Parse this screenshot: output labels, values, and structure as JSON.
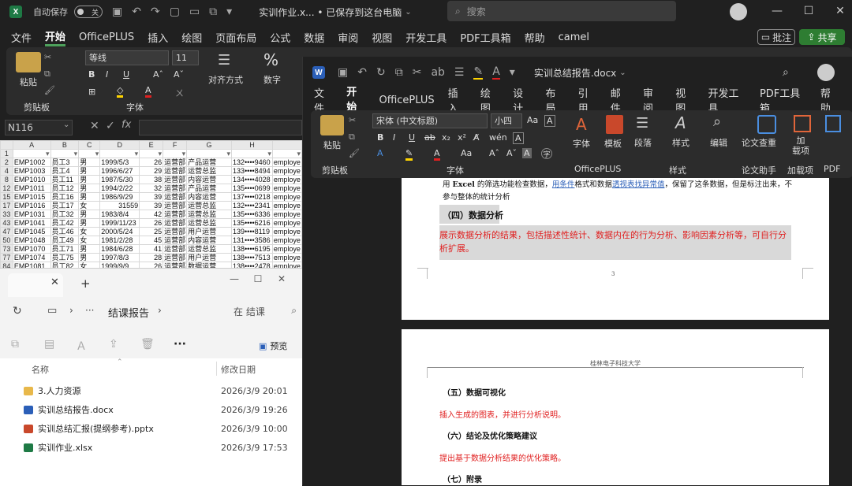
{
  "excel": {
    "autosave_label": "自动保存",
    "autosave_state": "关",
    "title": "实训作业.x... • 已保存到这台电脑",
    "search_placeholder": "搜索",
    "menu": [
      "文件",
      "开始",
      "OfficePLUS",
      "插入",
      "绘图",
      "页面布局",
      "公式",
      "数据",
      "审阅",
      "视图",
      "开发工具",
      "PDF工具箱",
      "帮助",
      "camel"
    ],
    "comment_btn": "批注",
    "share_btn": "共享",
    "ribbon": {
      "paste": "粘贴",
      "clipboard": "剪贴板",
      "font_name": "等线",
      "font_size": "11",
      "font_group": "字体",
      "align": "对齐方式",
      "number": "数字",
      "percent": "%"
    },
    "name_box": "N116",
    "columns": [
      "A",
      "B",
      "C",
      "D",
      "E",
      "F",
      "G",
      "H",
      ""
    ],
    "rows": [
      {
        "n": "2",
        "c": [
          "EMP1002",
          "员工3",
          "男",
          "1999/5/3",
          "26",
          "运营部",
          "产品运营",
          "132••••9460",
          "employe"
        ]
      },
      {
        "n": "4",
        "c": [
          "EMP1003",
          "员工4",
          "男",
          "1996/6/27",
          "29",
          "运营部",
          "运营总监",
          "133••••8494",
          "employe"
        ]
      },
      {
        "n": "8",
        "c": [
          "EMP1010",
          "员工11",
          "男",
          "1987/5/30",
          "38",
          "运营部",
          "内容运营",
          "134••••4028",
          "employe"
        ]
      },
      {
        "n": "12",
        "c": [
          "EMP1011",
          "员工12",
          "男",
          "1994/2/22",
          "32",
          "运营部",
          "产品运营",
          "135••••0699",
          "employe"
        ]
      },
      {
        "n": "15",
        "c": [
          "EMP1015",
          "员工16",
          "男",
          "1986/9/29",
          "39",
          "运营部",
          "内容运营",
          "137••••0218",
          "employe"
        ]
      },
      {
        "n": "17",
        "c": [
          "EMP1016",
          "员工17",
          "女",
          "31559",
          "39",
          "运营部",
          "运营总监",
          "132••••2341",
          "employe"
        ]
      },
      {
        "n": "33",
        "c": [
          "EMP1031",
          "员工32",
          "男",
          "1983/8/4",
          "42",
          "运营部",
          "运营总监",
          "135••••6336",
          "employe"
        ]
      },
      {
        "n": "43",
        "c": [
          "EMP1041",
          "员工42",
          "男",
          "1999/11/23",
          "26",
          "运营部",
          "运营总监",
          "135••••6216",
          "employe"
        ]
      },
      {
        "n": "47",
        "c": [
          "EMP1045",
          "员工46",
          "女",
          "2000/5/24",
          "25",
          "运营部",
          "用户运营",
          "139••••8119",
          "employe"
        ]
      },
      {
        "n": "50",
        "c": [
          "EMP1048",
          "员工49",
          "女",
          "1981/2/28",
          "45",
          "运营部",
          "内容运营",
          "131••••3586",
          "employe"
        ]
      },
      {
        "n": "73",
        "c": [
          "EMP1070",
          "员工71",
          "男",
          "1984/6/28",
          "41",
          "运营部",
          "运营总监",
          "138••••6195",
          "employe"
        ]
      },
      {
        "n": "77",
        "c": [
          "EMP1074",
          "员工75",
          "男",
          "1997/8/3",
          "28",
          "运营部",
          "用户运营",
          "138••••7513",
          "employe"
        ]
      },
      {
        "n": "84",
        "c": [
          "EMP1081",
          "员工82",
          "女",
          "1999/9/9",
          "26",
          "运营部",
          "数据运营",
          "138••••2478",
          "employe"
        ]
      }
    ]
  },
  "explorer": {
    "breadcrumb_more": "···",
    "breadcrumb": "结课报告",
    "search_placeholder": "在 结课",
    "preview": "预览",
    "more": "···",
    "col_name": "名称",
    "col_date": "修改日期",
    "files": [
      {
        "name": "3.人力资源",
        "date": "2026/3/9 20:01",
        "icon": "folder-icon",
        "color": "#e8b84a"
      },
      {
        "name": "实训总结报告.docx",
        "date": "2026/3/9 19:26",
        "icon": "word-file-icon",
        "color": "#2b5fb8"
      },
      {
        "name": "实训总结汇报(提纲参考).pptx",
        "date": "2026/3/9 10:00",
        "icon": "ppt-file-icon",
        "color": "#c9482b"
      },
      {
        "name": "实训作业.xlsx",
        "date": "2026/3/9 17:53",
        "icon": "excel-file-icon",
        "color": "#1e7a45"
      }
    ]
  },
  "word": {
    "title": "实训总结报告.docx",
    "menu": [
      "文件",
      "开始",
      "OfficePLUS",
      "插入",
      "绘图",
      "设计",
      "布局",
      "引用",
      "邮件",
      "审阅",
      "视图",
      "开发工具",
      "PDF工具箱",
      "帮助"
    ],
    "ribbon": {
      "paste": "粘贴",
      "clipboard": "剪贴板",
      "font_name": "宋体 (中文标题)",
      "font_size": "小四",
      "font_group": "字体",
      "font_btn": "字体",
      "template": "模板",
      "officeplus": "OfficePLUS",
      "paragraph": "段落",
      "styles": "样式",
      "styles_group": "样式",
      "editing": "编辑",
      "check": "论文查重",
      "assistant": "论文助手",
      "load_items": "加\n载项",
      "load_group": "加载项",
      "pdf": "PDF"
    },
    "p1_line1_a": "用 ",
    "p1_line1_excel": "Excel",
    "p1_line1_b": " 的筛选功能检查数据，",
    "p1_link1": "用条件",
    "p1_line1_c": "格式和数据",
    "p1_link2": "透视表找异常值",
    "p1_line1_d": "，保留了这条数据，但是标注出来，不",
    "p1_line2": "参与整体的统计分析",
    "h4": "（四）数据分析",
    "red4": "展示数据分析的结果，包括描述性统计、数据内在的行为分析、影响因素分析等，可自行分析扩展。",
    "page_num": "3",
    "header2": "桂林电子科技大学",
    "h5": "（五）数据可视化",
    "red5": "插入生成的图表，并进行分析说明。",
    "h6": "（六）结论及优化策略建议",
    "red6": "提出基于数据分析结果的优化策略。",
    "h7": "（七）附录"
  }
}
